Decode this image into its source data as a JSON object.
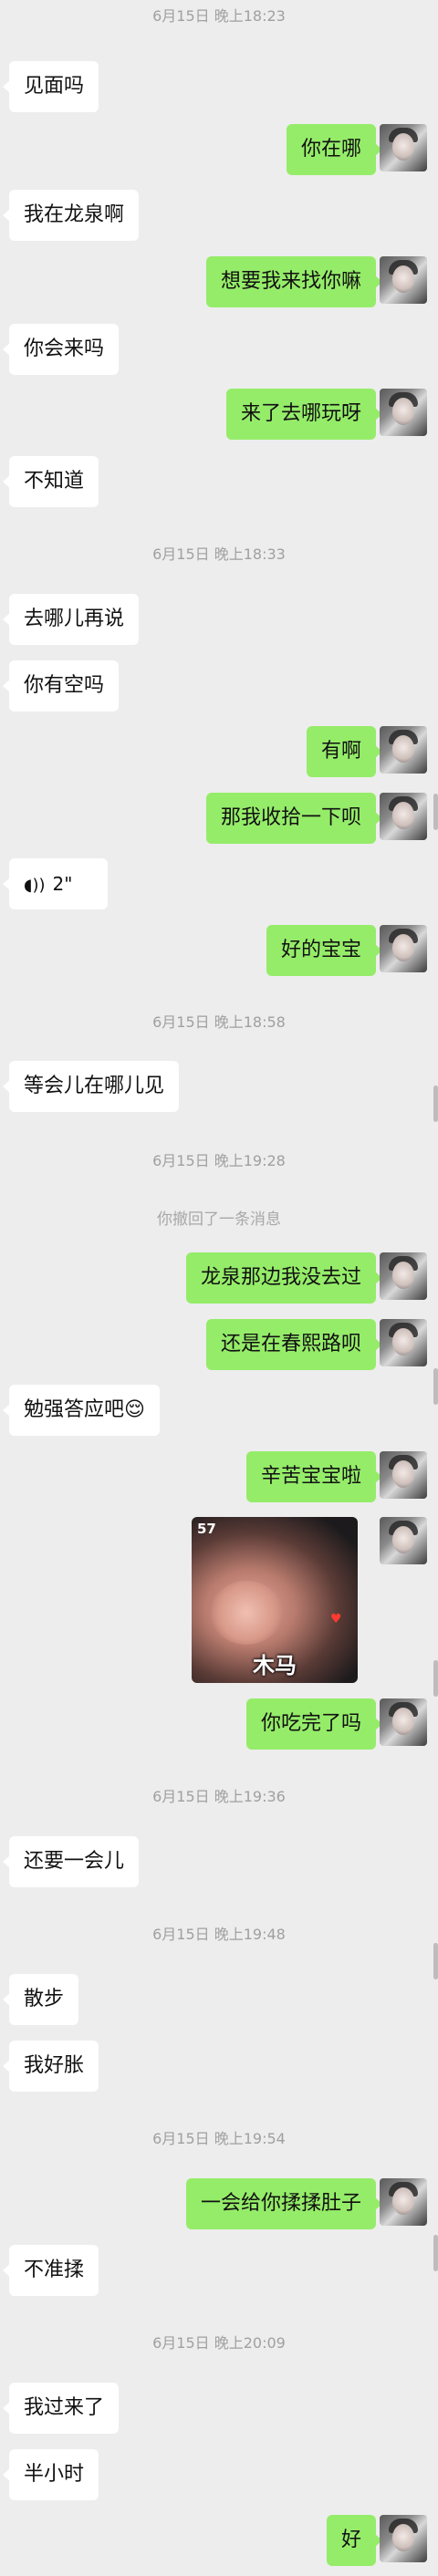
{
  "timestamps": [
    "6月15日 晚上18:23",
    "6月15日 晚上18:33",
    "6月15日 晚上18:58",
    "6月15日 晚上19:28",
    "6月15日 晚上19:36",
    "6月15日 晚上19:48",
    "6月15日 晚上19:54",
    "6月15日 晚上20:09"
  ],
  "recall_notice": "你撤回了一条消息",
  "messages": [
    "见面吗",
    "你在哪",
    "我在龙泉啊",
    "想要我来找你嘛",
    "你会来吗",
    "来了去哪玩呀",
    "不知道",
    "去哪儿再说",
    "你有空吗",
    "有啊",
    "那我收拾一下呗",
    "好的宝宝",
    "等会儿在哪儿见",
    "龙泉那边我没去过",
    "还是在春熙路呗",
    "勉强答应吧😌",
    "辛苦宝宝啦",
    "你吃完了吗",
    "还要一会儿",
    "散步",
    "我好胀",
    "一会给你揉揉肚子",
    "不准揉",
    "我过来了",
    "半小时",
    "好"
  ],
  "voice": {
    "icon": "voice-wave-icon",
    "duration": "2\""
  },
  "sticker": {
    "number": "57",
    "caption": "木马",
    "icon": "heart-icon"
  },
  "colors": {
    "background": "#ededed",
    "incoming": "#ffffff",
    "outgoing": "#95ec69",
    "meta_text": "#a0a0a0"
  }
}
